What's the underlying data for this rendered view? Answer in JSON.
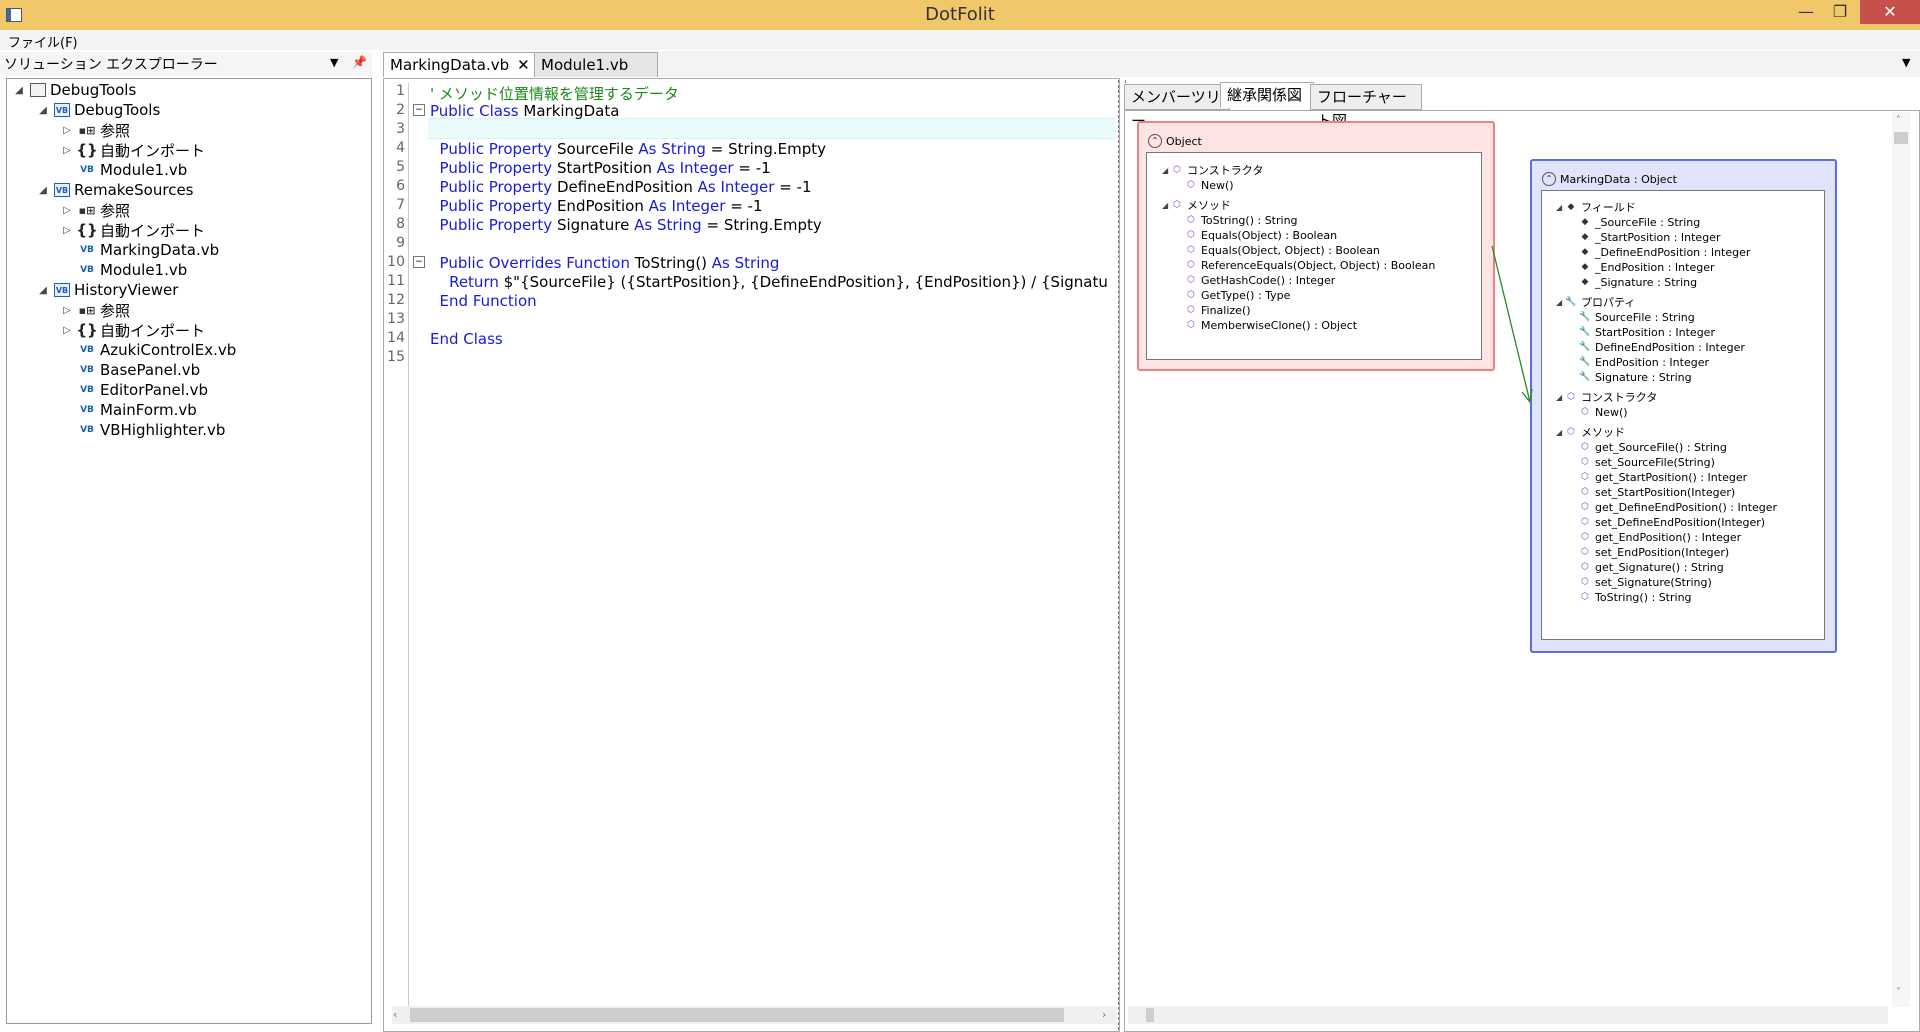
{
  "window": {
    "title": "DotFolit",
    "minimize": "—",
    "maximize": "❐",
    "close": "✕"
  },
  "menu": {
    "file": "ファイル(F)"
  },
  "solution_explorer": {
    "title": "ソリューション エクスプローラー",
    "items": [
      {
        "label": "DebugTools",
        "kind": "solution"
      },
      {
        "label": "DebugTools",
        "kind": "project"
      },
      {
        "label": "参照",
        "kind": "ref"
      },
      {
        "label": "自動インポート",
        "kind": "import"
      },
      {
        "label": "Module1.vb",
        "kind": "vb"
      },
      {
        "label": "RemakeSources",
        "kind": "project"
      },
      {
        "label": "参照",
        "kind": "ref"
      },
      {
        "label": "自動インポート",
        "kind": "import"
      },
      {
        "label": "MarkingData.vb",
        "kind": "vb"
      },
      {
        "label": "Module1.vb",
        "kind": "vb"
      },
      {
        "label": "HistoryViewer",
        "kind": "project"
      },
      {
        "label": "参照",
        "kind": "ref"
      },
      {
        "label": "自動インポート",
        "kind": "import"
      },
      {
        "label": "AzukiControlEx.vb",
        "kind": "vb"
      },
      {
        "label": "BasePanel.vb",
        "kind": "vb"
      },
      {
        "label": "EditorPanel.vb",
        "kind": "vb"
      },
      {
        "label": "MainForm.vb",
        "kind": "vb"
      },
      {
        "label": "VBHighlighter.vb",
        "kind": "vb"
      }
    ]
  },
  "editor": {
    "tabs": [
      {
        "label": "MarkingData.vb",
        "active": true
      },
      {
        "label": "Module1.vb",
        "active": false
      }
    ],
    "close_glyph": "✕",
    "line_numbers": [
      "1",
      "2",
      "3",
      "4",
      "5",
      "6",
      "7",
      "8",
      "9",
      "10",
      "11",
      "12",
      "13",
      "14",
      "15"
    ],
    "code": {
      "l1_comment": "' メソッド位置情報を管理するデータ",
      "l2_kw": "Public Class",
      "l2_name": " MarkingData",
      "l4_kw": "Public Property",
      "l4_a": " SourceFile ",
      "l4_as": "As",
      "l4_t": " String",
      "l4_b": " = String.Empty",
      "l5_kw": "Public Property",
      "l5_a": " StartPosition ",
      "l5_as": "As",
      "l5_t": " Integer",
      "l5_b": " = -1",
      "l6_kw": "Public Property",
      "l6_a": " DefineEndPosition ",
      "l6_as": "As",
      "l6_t": " Integer",
      "l6_b": " = -1",
      "l7_kw": "Public Property",
      "l7_a": " EndPosition ",
      "l7_as": "As",
      "l7_t": " Integer",
      "l7_b": " = -1",
      "l8_kw": "Public Property",
      "l8_a": " Signature ",
      "l8_as": "As",
      "l8_t": " String",
      "l8_b": " = String.Empty",
      "l10_kw": "Public Overrides Function",
      "l10_a": " ToString() ",
      "l10_as": "As",
      "l10_t": " String",
      "l11_kw": "Return",
      "l11_a": " $\"{SourceFile} ({StartPosition}, {DefineEndPosition}, {EndPosition}) / {Signatu",
      "l12_kw": "End Function",
      "l14_kw": "End Class"
    }
  },
  "right_panel": {
    "tabs": [
      "メンバーツリー",
      "継承関係図",
      "フローチャート図"
    ],
    "object_class": {
      "title": "Object",
      "groups": [
        {
          "label": "コンストラクタ",
          "members": [
            "New()"
          ]
        },
        {
          "label": "メソッド",
          "members": [
            "ToString() : String",
            "Equals(Object) : Boolean",
            "Equals(Object, Object) : Boolean",
            "ReferenceEquals(Object, Object) : Boolean",
            "GetHashCode() : Integer",
            "GetType() : Type",
            "Finalize()",
            "MemberwiseClone() : Object"
          ]
        }
      ]
    },
    "marking_class": {
      "title": "MarkingData : Object",
      "groups": [
        {
          "label": "フィールド",
          "members": [
            "_SourceFile : String",
            "_StartPosition : Integer",
            "_DefineEndPosition : Integer",
            "_EndPosition : Integer",
            "_Signature : String"
          ]
        },
        {
          "label": "プロパティ",
          "members": [
            "SourceFile : String",
            "StartPosition : Integer",
            "DefineEndPosition : Integer",
            "EndPosition : Integer",
            "Signature : String"
          ]
        },
        {
          "label": "コンストラクタ",
          "members": [
            "New()"
          ]
        },
        {
          "label": "メソッド",
          "members": [
            "get_SourceFile() : String",
            "set_SourceFile(String)",
            "get_StartPosition() : Integer",
            "set_StartPosition(Integer)",
            "get_DefineEndPosition() : Integer",
            "set_DefineEndPosition(Integer)",
            "get_EndPosition() : Integer",
            "set_EndPosition(Integer)",
            "get_Signature() : String",
            "set_Signature(String)",
            "ToString() : String"
          ]
        }
      ]
    }
  },
  "colors": {
    "titlebar": "#f0c86a",
    "keyword": "#1a1adb",
    "comment": "#1a8a1a",
    "object_border": "#f08080",
    "derived_border": "#5a6ee0",
    "inherit_arrow": "#2a8a2a"
  }
}
